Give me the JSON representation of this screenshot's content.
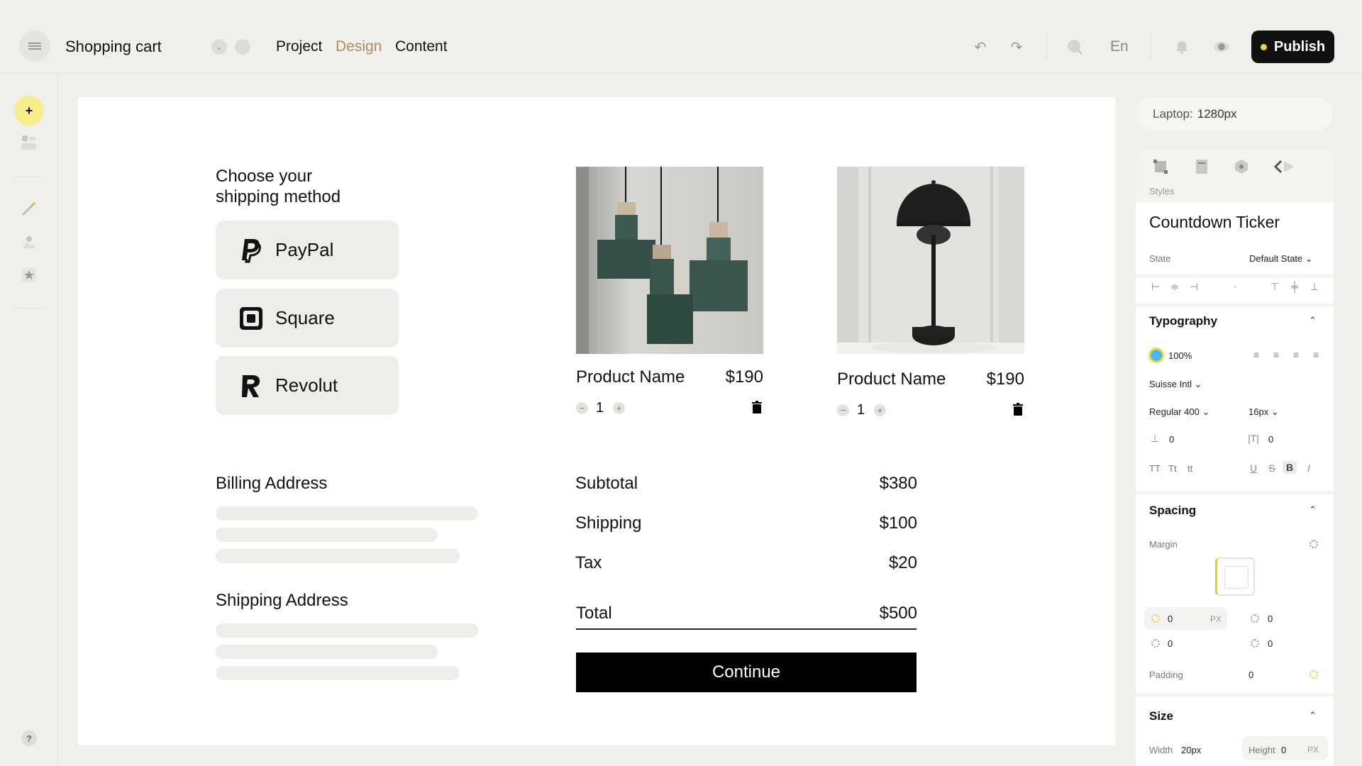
{
  "topbar": {
    "title": "Shopping cart",
    "tabs": [
      {
        "label": "Project",
        "active": false
      },
      {
        "label": "Design",
        "active": true
      },
      {
        "label": "Content",
        "active": false
      }
    ],
    "language": "En",
    "publish_label": "Publish"
  },
  "canvas": {
    "shipping_title": "Choose your shipping method",
    "payment_methods": [
      {
        "label": "PayPal",
        "icon": "paypal-icon"
      },
      {
        "label": "Square",
        "icon": "square-icon"
      },
      {
        "label": "Revolut",
        "icon": "revolut-icon"
      }
    ],
    "billing_title": "Billing Address",
    "shipping_address_title": "Shipping Address",
    "products": [
      {
        "name": "Product Name",
        "price": "$190",
        "qty": "1"
      },
      {
        "name": "Product Name",
        "price": "$190",
        "qty": "1"
      }
    ],
    "summary": {
      "subtotal_label": "Subtotal",
      "subtotal": "$380",
      "shipping_label": "Shipping",
      "shipping": "$100",
      "tax_label": "Tax",
      "tax": "$20",
      "total_label": "Total",
      "total": "$500"
    },
    "continue_label": "Continue"
  },
  "panel": {
    "device_label": "Laptop:",
    "device_value": "1280px",
    "styles_label": "Styles",
    "component_name": "Countdown Ticker",
    "state_label": "State",
    "state_value": "Default State",
    "typography_title": "Typography",
    "opacity": "100%",
    "color": "#4db8e8",
    "font_family": "Suisse Intl",
    "font_weight": "Regular 400",
    "font_size": "16px",
    "line_height": "0",
    "letter_spacing": "0",
    "case_options": [
      "TT",
      "Tt",
      "tt"
    ],
    "spacing_title": "Spacing",
    "margin_label": "Margin",
    "margin_top": "0",
    "margin_right": "0",
    "margin_bottom": "0",
    "margin_left": "0",
    "unit": "PX",
    "padding_label": "Padding",
    "padding": "0",
    "size_title": "Size",
    "width_label": "Width",
    "width_value": "20px",
    "height_label": "Height",
    "height_value": "0",
    "height_unit": "PX"
  },
  "help_label": "?"
}
